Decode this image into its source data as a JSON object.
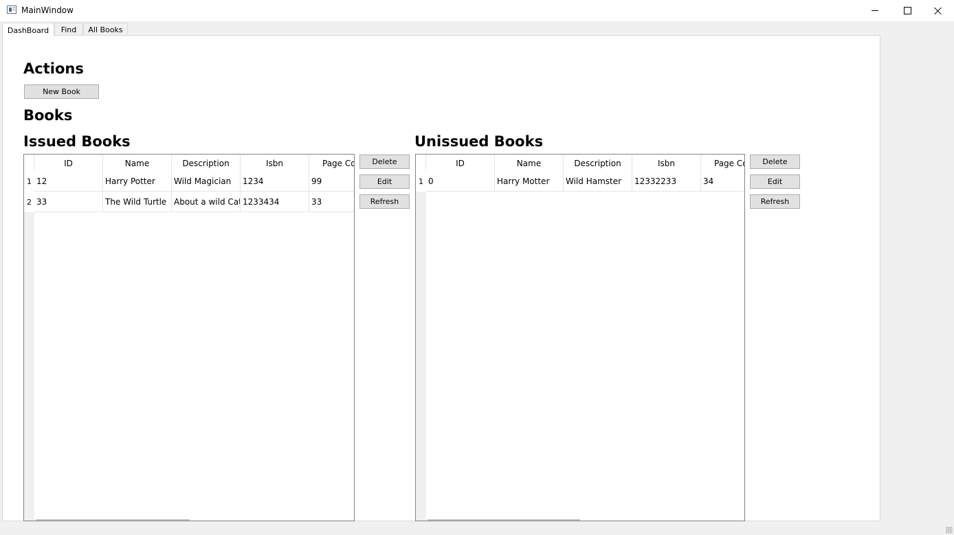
{
  "window": {
    "title": "MainWindow"
  },
  "tabs": [
    {
      "label": "DashBoard",
      "active": true
    },
    {
      "label": "Find",
      "active": false
    },
    {
      "label": "All Books",
      "active": false
    }
  ],
  "dashboard": {
    "actions_heading": "Actions",
    "new_book_label": "New Book",
    "books_heading": "Books"
  },
  "issued": {
    "heading": "Issued Books",
    "columns": [
      "ID",
      "Name",
      "Description",
      "Isbn",
      "Page Count"
    ],
    "rows": [
      {
        "num": "1",
        "cells": [
          "12",
          "Harry Potter",
          "Wild Magician",
          "1234",
          "99"
        ]
      },
      {
        "num": "2",
        "cells": [
          "33",
          "The Wild Turtle",
          "About a wild Cat",
          "1233434",
          "33"
        ]
      }
    ],
    "buttons": {
      "delete": "Delete",
      "edit": "Edit",
      "refresh": "Refresh"
    }
  },
  "unissued": {
    "heading": "Unissued Books",
    "columns": [
      "ID",
      "Name",
      "Description",
      "Isbn",
      "Page Count"
    ],
    "rows": [
      {
        "num": "1",
        "cells": [
          "0",
          "Harry Motter",
          "Wild Hamster",
          "12332233",
          "34"
        ]
      }
    ],
    "buttons": {
      "delete": "Delete",
      "edit": "Edit",
      "refresh": "Refresh"
    }
  }
}
